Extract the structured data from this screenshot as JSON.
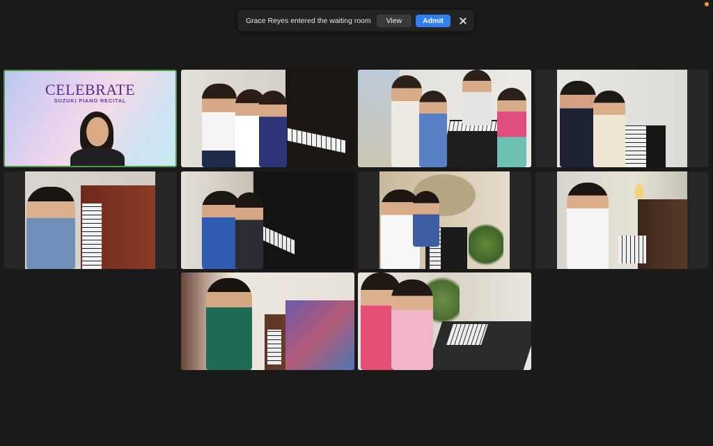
{
  "colors": {
    "background": "#1a1a1a",
    "admit_button": "#2f7ff0",
    "status_dot": "#e8a33a",
    "active_speaker_border": "#4f9d4a"
  },
  "notification": {
    "message": "Grace Reyes entered the waiting room",
    "view_label": "View",
    "admit_label": "Admit",
    "close_icon": "close-icon"
  },
  "tiles": [
    {
      "id": "tile-1",
      "title": "CELEBRATE",
      "subtitle": "SUZUKI PIANO RECITAL",
      "active": true
    },
    {
      "id": "tile-2"
    },
    {
      "id": "tile-3"
    },
    {
      "id": "tile-4"
    },
    {
      "id": "tile-5"
    },
    {
      "id": "tile-6"
    },
    {
      "id": "tile-7"
    },
    {
      "id": "tile-8"
    },
    {
      "id": "tile-9"
    },
    {
      "id": "tile-10"
    }
  ]
}
